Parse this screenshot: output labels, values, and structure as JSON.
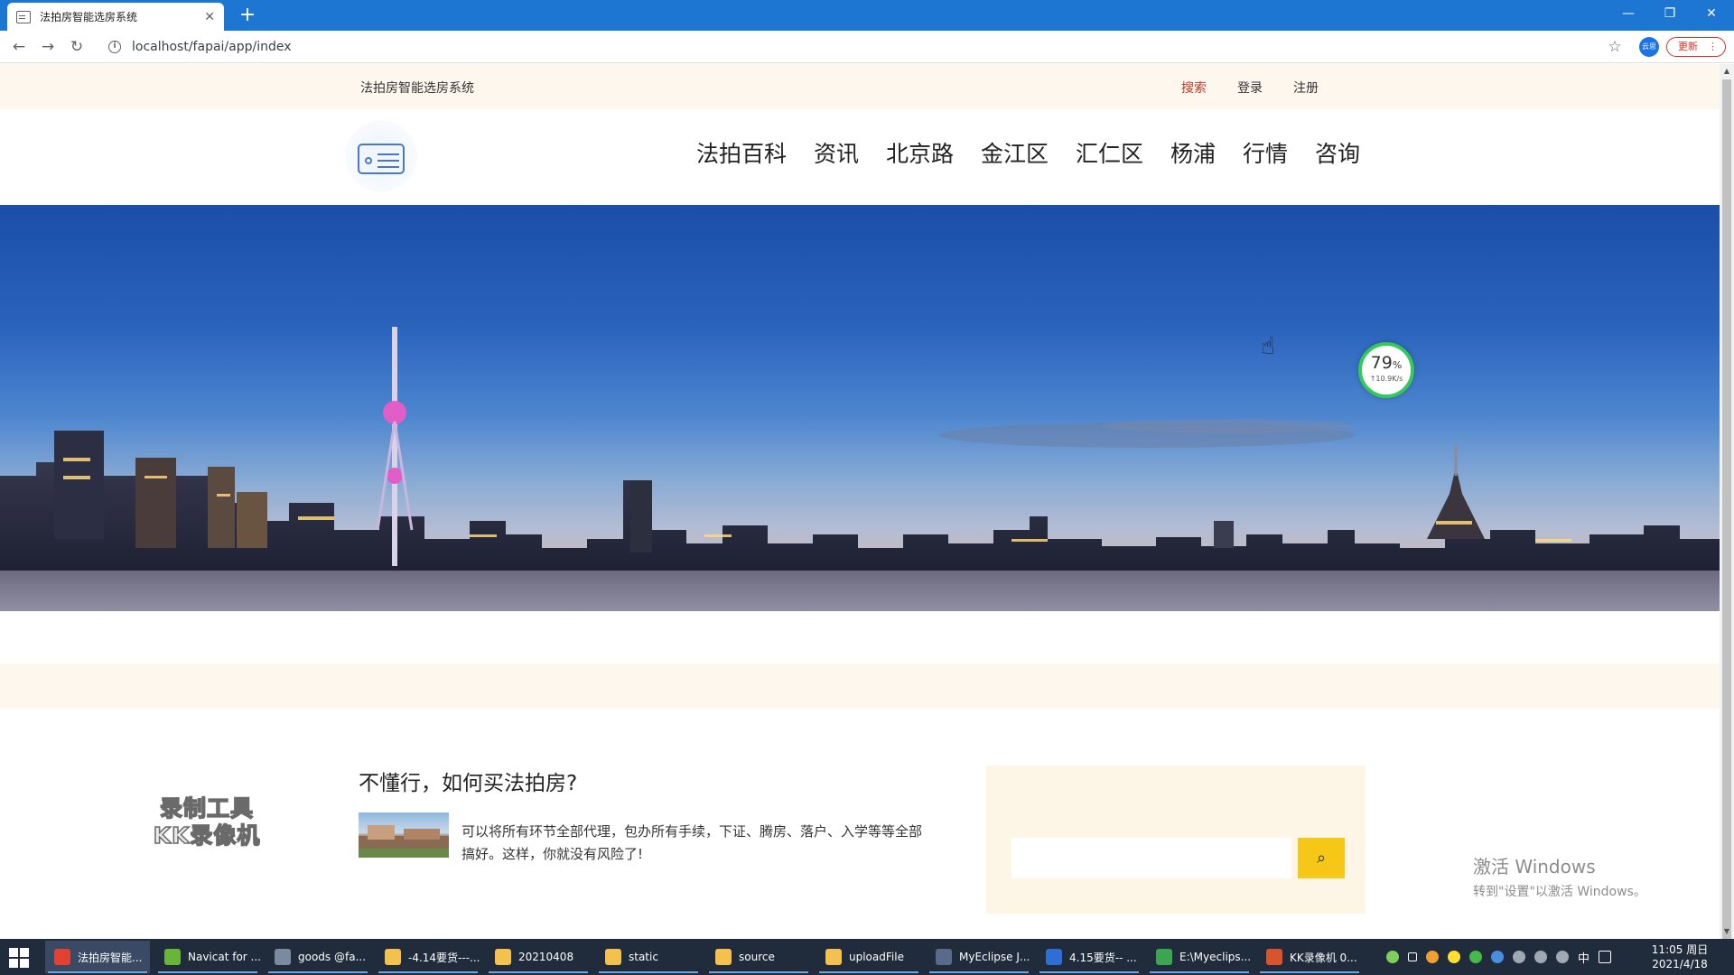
{
  "browser": {
    "tab_title": "法拍房智能选房系统",
    "tab_close": "✕",
    "new_tab": "+",
    "win_min": "—",
    "win_restore": "❐",
    "win_close": "✕",
    "back": "←",
    "forward": "→",
    "reload": "↻",
    "info": "i",
    "url": "localhost/fapai/app/index",
    "star": "☆",
    "profile": "云思",
    "update_label": "更新",
    "update_menu": "⋮"
  },
  "topbar": {
    "site_name": "法拍房智能选房系统",
    "links": {
      "search": "搜索",
      "login": "登录",
      "register": "注册"
    }
  },
  "nav": {
    "items": [
      "法拍百科",
      "资讯",
      "北京路",
      "金江区",
      "汇仁区",
      "杨浦",
      "行情",
      "咨询"
    ]
  },
  "widget": {
    "percent": "79",
    "percent_sign": "%",
    "speed": "↑10.9K/s"
  },
  "cursor": "☝",
  "watermark": {
    "line1": "录制工具",
    "line2": "KK录像机"
  },
  "article": {
    "title": "不懂行，如何买法拍房?",
    "text": "可以将所有环节全部代理，包办所有手续，下证、腾房、落户、入学等等全部搞好。这样，你就没有风险了!"
  },
  "search_panel": {
    "input_value": "",
    "button_icon": "⌕"
  },
  "activation": {
    "line1": "激活 Windows",
    "line2": "转到\"设置\"以激活 Windows。"
  },
  "taskbar": {
    "items": [
      {
        "label": "法拍房智能...",
        "color": "#e34133"
      },
      {
        "label": "Navicat for ...",
        "color": "#69b53a"
      },
      {
        "label": "goods @fa...",
        "color": "#7a8aa0"
      },
      {
        "label": "-4.14要货---...",
        "color": "#f2c14e"
      },
      {
        "label": "20210408",
        "color": "#f2c14e"
      },
      {
        "label": "static",
        "color": "#f2c14e"
      },
      {
        "label": "source",
        "color": "#f2c14e"
      },
      {
        "label": "uploadFile",
        "color": "#f2c14e"
      },
      {
        "label": "MyEclipse J...",
        "color": "#5a6b8a"
      },
      {
        "label": "4.15要货-- ...",
        "color": "#2f6ed3"
      },
      {
        "label": "E:\\Myeclips...",
        "color": "#3ba550"
      },
      {
        "label": "KK录像机 0...",
        "color": "#d9532c"
      }
    ],
    "tray_text": "中",
    "clock_time": "11:05 周日",
    "clock_date": "2021/4/18"
  }
}
